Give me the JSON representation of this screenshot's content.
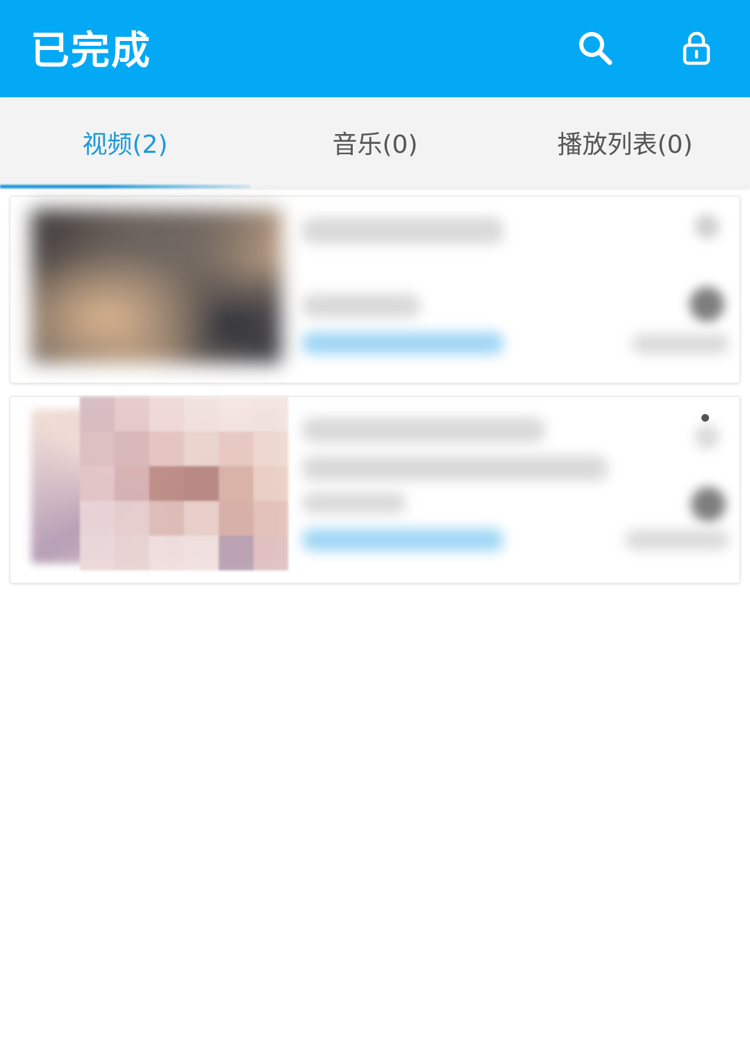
{
  "app_bar": {
    "title": "已完成",
    "actions": [
      {
        "icon": "search-icon"
      },
      {
        "icon": "lock-icon"
      }
    ],
    "background": "#03a9f4"
  },
  "tabs": [
    {
      "label": "视频(2)",
      "selected": true
    },
    {
      "label": "音乐(0)",
      "selected": false
    },
    {
      "label": "播放列表(0)",
      "selected": false
    }
  ],
  "accent_color": "#1e9ad8",
  "downloads": [
    {
      "thumbnail": "blurred-video-thumbnail"
    },
    {
      "thumbnail": "pixelated-video-thumbnail"
    }
  ]
}
